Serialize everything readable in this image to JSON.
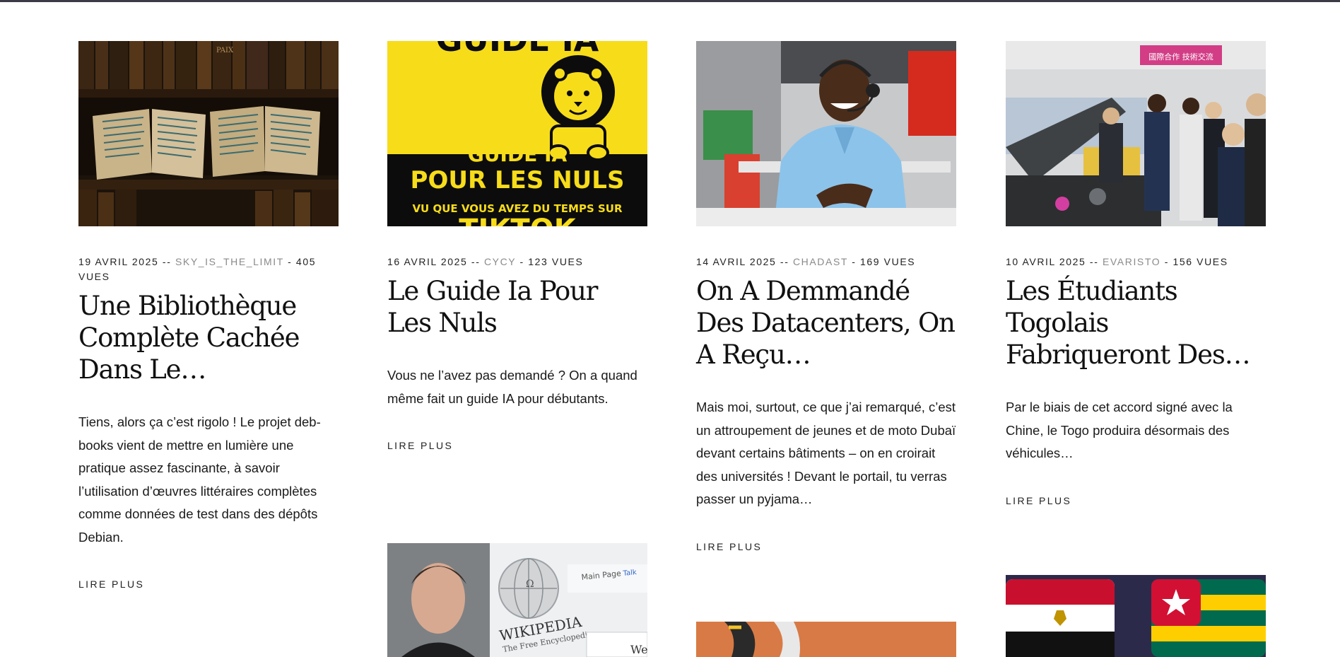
{
  "articles": [
    {
      "date": "19 AVRIL 2025",
      "sep1": " -- ",
      "author": "SKY_IS_THE_LIMIT",
      "views": " - 405 VUES",
      "title": "Une Bibliothèque Complète Cachée Dans Le…",
      "excerpt": "Tiens, alors ça c’est rigolo ! Le projet deb-books vient de mettre en lumière une pratique assez fascinante, à savoir l’utilisation d’œuvres littéraires complètes comme données de test dans des dépôts Debian.",
      "more": "LIRE PLUS",
      "image_text": "PAIX"
    },
    {
      "date": "16 AVRIL 2025",
      "sep1": " -- ",
      "author": "CYCY",
      "views": " - 123 VUES",
      "title": "Le Guide Ia Pour Les Nuls",
      "excerpt": "Vous ne l’avez pas demandé ? On a quand même fait un guide IA pour débutants.",
      "more": "LIRE PLUS",
      "image_text": {
        "top": "GUIDE IA",
        "line1": "GUIDE IA",
        "line2": "POUR LES NULS",
        "line3": "VU QUE VOUS AVEZ DU TEMPS SUR",
        "line4": "TIKTOK"
      }
    },
    {
      "date": "14 AVRIL 2025",
      "sep1": " -- ",
      "author": "CHADAST",
      "views": " - 169 VUES",
      "title": "On A Demmandé Des Datacenters, On A Reçu…",
      "excerpt": "Mais moi, surtout, ce que j’ai remarqué, c’est un attroupement de jeunes et de moto Dubaï devant certains bâtiments – on en croirait des universités ! Devant le portail, tu verras passer un pyjama…",
      "more": "LIRE PLUS"
    },
    {
      "date": "10 AVRIL 2025",
      "sep1": " -- ",
      "author": "EVARISTO",
      "views": " - 156 VUES",
      "title": "Les Étudiants Togolais Fabriqueront Des…",
      "excerpt": "Par le biais de cet accord signé avec la Chine, le Togo produira désormais des véhicules…",
      "more": "LIRE PLUS",
      "image_text": "國際合作 技術交流"
    }
  ],
  "second_row": {
    "wiki_title": "WIKIPEDIA",
    "wiki_subtitle": "The Free Encyclopedia",
    "wiki_tab1": "Main Page",
    "wiki_tab2": "Talk",
    "wiki_search": "We"
  },
  "colors": {
    "guide_yellow": "#f7dc1a",
    "guide_black": "#0c0c0c",
    "link_grey": "#8a8a8a",
    "top_border": "#3b3b46"
  }
}
